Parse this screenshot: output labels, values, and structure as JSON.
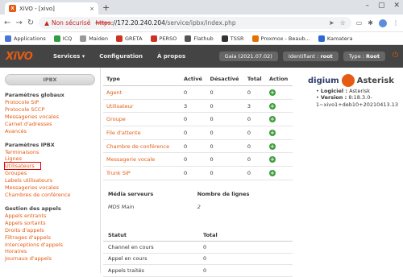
{
  "browser": {
    "tab_title": "XiVO - [xivo]",
    "tab_favicon_text": "X",
    "close_tab": "×",
    "new_tab": "+",
    "win_minimize": "–",
    "win_maximize": "▢",
    "win_close": "✕",
    "nav_back": "←",
    "nav_forward": "→",
    "nav_reload": "↻",
    "warning_icon": "▲",
    "not_secure": "Non sécurisé",
    "url_scheme": "https",
    "url_host": "://172.20.240.204",
    "url_path": "/service/ipbx/index.php",
    "send_icon": "➤",
    "star_icon": "☆",
    "cast_icon": "▭",
    "puzzle_icon": "✱",
    "menu_icon": "⋮"
  },
  "bookmarks": [
    {
      "label": "Applications",
      "color": "#4a78d4"
    },
    {
      "label": "ICQ",
      "color": "#2f9e44"
    },
    {
      "label": "Maiden",
      "color": "#999999"
    },
    {
      "label": "GRETA",
      "color": "#cc3322"
    },
    {
      "label": "PERSO",
      "color": "#cc3322"
    },
    {
      "label": "Flathub",
      "color": "#555555"
    },
    {
      "label": "TSSR",
      "color": "#333333"
    },
    {
      "label": "Proxmox - Beaub...",
      "color": "#e57000"
    },
    {
      "label": "Kamatera",
      "color": "#2b6ad0"
    }
  ],
  "xivo": {
    "logo": "XiVO",
    "menu": [
      "Services ▾",
      "Configuration",
      "À propos"
    ],
    "pill_version": "Gaia (2021.07.02)",
    "pill_user_label": "Identifiant : ",
    "pill_user": "root",
    "pill_type_label": "Type : ",
    "pill_type": "Root",
    "power_icon": "⏻"
  },
  "sidebar": {
    "header": "IPBX",
    "sections": [
      {
        "title": "Paramètres globaux",
        "items": [
          "Protocole SIP",
          "Protocole SCCP",
          "Messageries vocales",
          "Carnet d'adresses",
          "Avancés"
        ]
      },
      {
        "title": "Paramètres IPBX",
        "items": [
          "Terminaisons",
          "Lignes",
          "Utilisateurs",
          "Groupes",
          "Labels utilisateurs",
          "Messageries vocales",
          "Chambres de conférence"
        ]
      },
      {
        "title": "Gestion des appels",
        "items": [
          "Appels entrants",
          "Appels sortants",
          "Droits d'appels",
          "Filtrages d'appels",
          "Interceptions d'appels",
          "Horaires",
          "Journaux d'appels"
        ]
      }
    ]
  },
  "stats": {
    "headers": [
      "Type",
      "Activé",
      "Désactivé",
      "Total",
      "Action"
    ],
    "rows": [
      {
        "type": "Agent",
        "active": "0",
        "inactive": "0",
        "total": "0"
      },
      {
        "type": "Utilisateur",
        "active": "3",
        "inactive": "0",
        "total": "3"
      },
      {
        "type": "Groupe",
        "active": "0",
        "inactive": "0",
        "total": "0"
      },
      {
        "type": "File d'attente",
        "active": "0",
        "inactive": "0",
        "total": "0"
      },
      {
        "type": "Chambre de conférence",
        "active": "0",
        "inactive": "0",
        "total": "0"
      },
      {
        "type": "Messagerie vocale",
        "active": "0",
        "inactive": "0",
        "total": "0"
      },
      {
        "type": "Trunk SIP",
        "active": "0",
        "inactive": "0",
        "total": "0"
      }
    ],
    "action_symbol": "+"
  },
  "brand": {
    "digium": "digium",
    "asterisk": "Asterisk",
    "logiciel_label": "Logiciel :",
    "logiciel_value": "Asterisk",
    "version_label": "Version :",
    "version_value": "8:18.3.0-",
    "version_value2": "1~xivo1+deb10+20210413.13"
  },
  "media": {
    "headers": [
      "Média serveurs",
      "Nombre de lignes"
    ],
    "row": {
      "name": "MDS Main",
      "lines": "2"
    }
  },
  "status": {
    "headers": [
      "Statut",
      "Total"
    ],
    "rows": [
      {
        "label": "Channel en cours",
        "total": "0"
      },
      {
        "label": "Appel en cours",
        "total": "0"
      },
      {
        "label": "Appels traités",
        "total": "0"
      }
    ]
  }
}
